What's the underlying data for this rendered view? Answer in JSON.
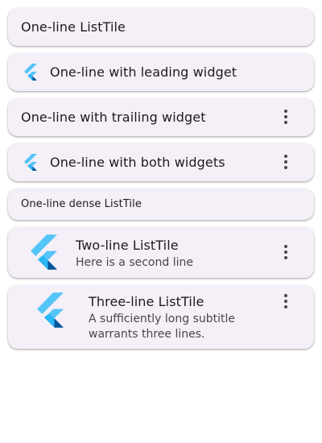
{
  "tiles": [
    {
      "title": "One-line ListTile",
      "leading": null,
      "trailing": null
    },
    {
      "title": "One-line with leading widget",
      "leading": "flutter-logo-icon",
      "trailing": null
    },
    {
      "title": "One-line with trailing widget",
      "leading": null,
      "trailing": "more-vert-icon"
    },
    {
      "title": "One-line with both widgets",
      "leading": "flutter-logo-icon",
      "trailing": "more-vert-icon"
    },
    {
      "title": "One-line dense ListTile",
      "leading": null,
      "trailing": null,
      "dense": true
    },
    {
      "title": "Two-line ListTile",
      "subtitle": "Here is a second line",
      "leading": "flutter-logo-icon",
      "trailing": "more-vert-icon"
    },
    {
      "title": "Three-line ListTile",
      "subtitle_lines": [
        "A sufficiently long subtitle",
        "warrants three lines."
      ],
      "leading": "flutter-logo-icon",
      "trailing": "more-vert-icon"
    }
  ],
  "colors": {
    "card_background": "#f5eff7",
    "flutter_light_blue": "#54c5f8",
    "flutter_dark_blue": "#01579b",
    "flutter_mid_blue": "#29b6f6",
    "more_icon": "#49454f"
  }
}
